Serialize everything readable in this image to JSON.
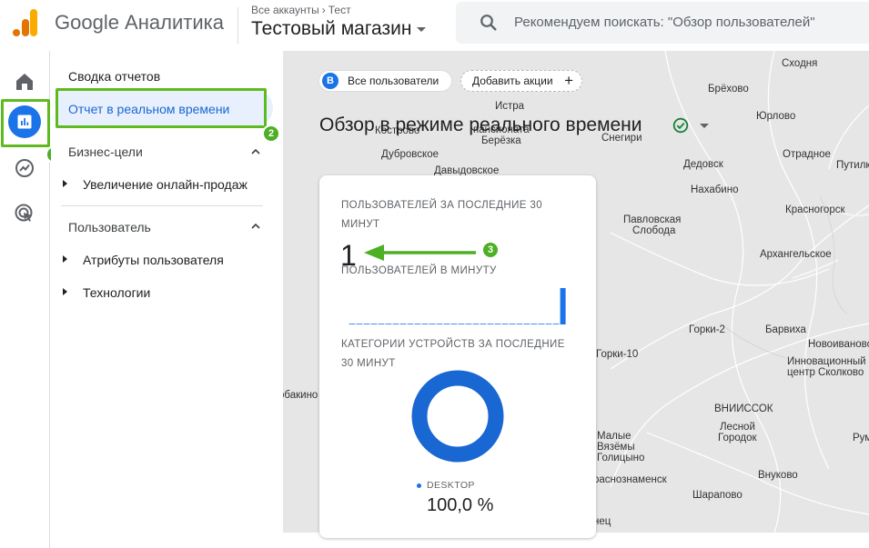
{
  "header": {
    "brand": "Google Аналитика",
    "breadcrumb_account": "Все аккаунты",
    "breadcrumb_sub": "Тест",
    "property": "Тестовый магазин",
    "search_placeholder": "Рекомендуем поискать: \"Обзор пользователей\""
  },
  "rail": {
    "icons": [
      "home-icon",
      "reports-icon",
      "explore-icon",
      "advertising-icon"
    ],
    "active": "reports-icon"
  },
  "nav": {
    "summary": "Сводка отчетов",
    "realtime": "Отчет в реальном времени",
    "section_business": "Бизнес-цели",
    "business_item": "Увеличение онлайн-продаж",
    "section_user": "Пользователь",
    "user_attributes": "Атрибуты пользователя",
    "technologies": "Технологии"
  },
  "main": {
    "chip_all_users_badge": "B",
    "chip_all_users": "Все пользователи",
    "chip_add_action": "Добавить акции",
    "title": "Обзор в режиме реального времени"
  },
  "card": {
    "users_30min_label": "ПОЛЬЗОВАТЕЛЕЙ ЗА ПОСЛЕДНИЕ 30 МИНУТ",
    "users_30min_value": "1",
    "per_minute_label": "ПОЛЬЗОВАТЕЛЕЙ В МИНУТУ",
    "per_minute_values": [
      0,
      0,
      0,
      0,
      0,
      0,
      0,
      0,
      0,
      0,
      0,
      0,
      0,
      0,
      0,
      0,
      0,
      0,
      0,
      0,
      0,
      0,
      0,
      0,
      0,
      0,
      0,
      0,
      0,
      1
    ],
    "device_label": "КАТЕГОРИИ УСТРОЙСТВ ЗА ПОСЛЕДНИЕ 30 МИНУТ",
    "device_name": "DESKTOP",
    "device_pct": "100,0 %"
  },
  "map_places": [
    "Сходня",
    "Брёхово",
    "Юрлово",
    "Истра",
    "Кострово",
    "пансионата",
    "Берёзка",
    "Снегири",
    "Отрадное",
    "Путилково",
    "Дубровское",
    "Давыдовское",
    "Дедовск",
    "Нахабино",
    "Павловская",
    "Слобода",
    "Красногорск",
    "Архангельское",
    "Горки-2",
    "Барвиха",
    "Новоивановское",
    "Горки-10",
    "Инновационный",
    "центр Сколково",
    "обакино",
    "ВНИИССОК",
    "Лесной",
    "Городок",
    "Малые",
    "Вязёмы",
    "Голицыно",
    "раснознаменск",
    "Внуково",
    "Шарапово",
    "нец",
    "Рум"
  ],
  "annotations": {
    "badge_1": "1",
    "badge_2": "2",
    "badge_3": "3",
    "highlight_color": "#5dbb1f",
    "accent": "#1a73e8"
  }
}
